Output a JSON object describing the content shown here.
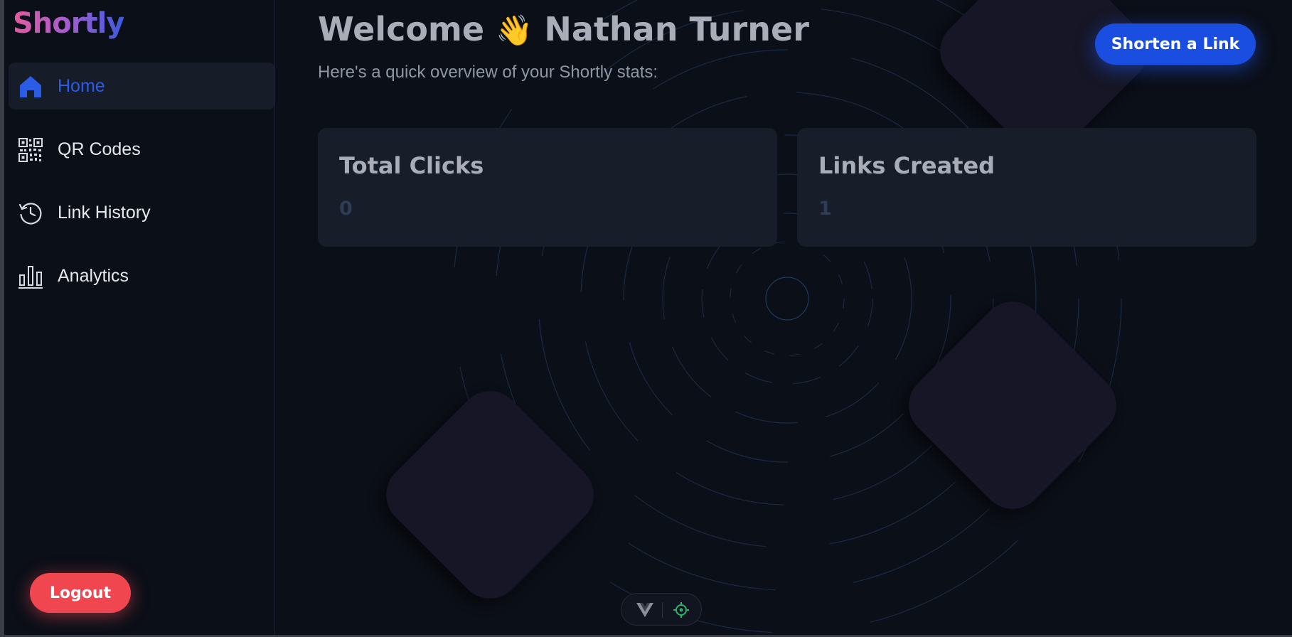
{
  "app": {
    "logo": "Shortly"
  },
  "sidebar": {
    "items": [
      {
        "label": "Home",
        "icon": "home-icon",
        "active": true
      },
      {
        "label": "QR Codes",
        "icon": "qr-code-icon",
        "active": false
      },
      {
        "label": "Link History",
        "icon": "history-icon",
        "active": false
      },
      {
        "label": "Analytics",
        "icon": "bar-chart-icon",
        "active": false
      }
    ],
    "logout_label": "Logout"
  },
  "header": {
    "welcome_prefix": "Welcome",
    "wave_emoji": "👋",
    "user_name": "Nathan Turner",
    "subtitle": "Here's a quick overview of your Shortly stats:",
    "shorten_label": "Shorten a Link"
  },
  "stats": [
    {
      "title": "Total Clicks",
      "value": "0"
    },
    {
      "title": "Links Created",
      "value": "1"
    }
  ],
  "colors": {
    "background": "#0b0f18",
    "accent": "#1a4ee0",
    "active_nav": "#2b5ce6",
    "logout": "#ef4650",
    "card": "#171d29"
  }
}
